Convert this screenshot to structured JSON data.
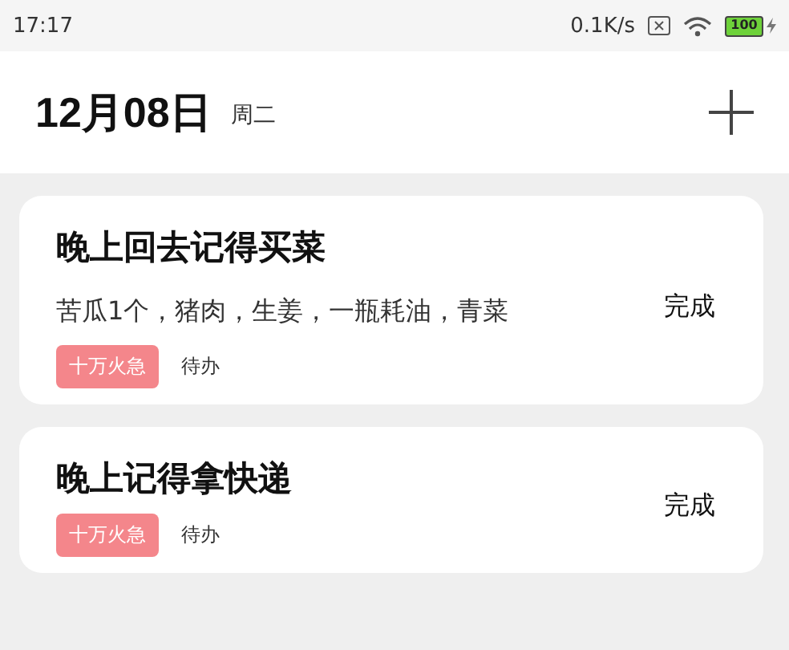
{
  "status_bar": {
    "time": "17:17",
    "speed": "0.1K/s",
    "battery": "100"
  },
  "header": {
    "date": "12月08日",
    "weekday": "周二"
  },
  "tasks": [
    {
      "title": "晚上回去记得买菜",
      "note": "苦瓜1个，猪肉，生姜，一瓶耗油，青菜",
      "tag": "十万火急",
      "status": "待办",
      "action": "完成"
    },
    {
      "title": "晚上记得拿快递",
      "tag": "十万火急",
      "status": "待办",
      "action": "完成"
    }
  ]
}
